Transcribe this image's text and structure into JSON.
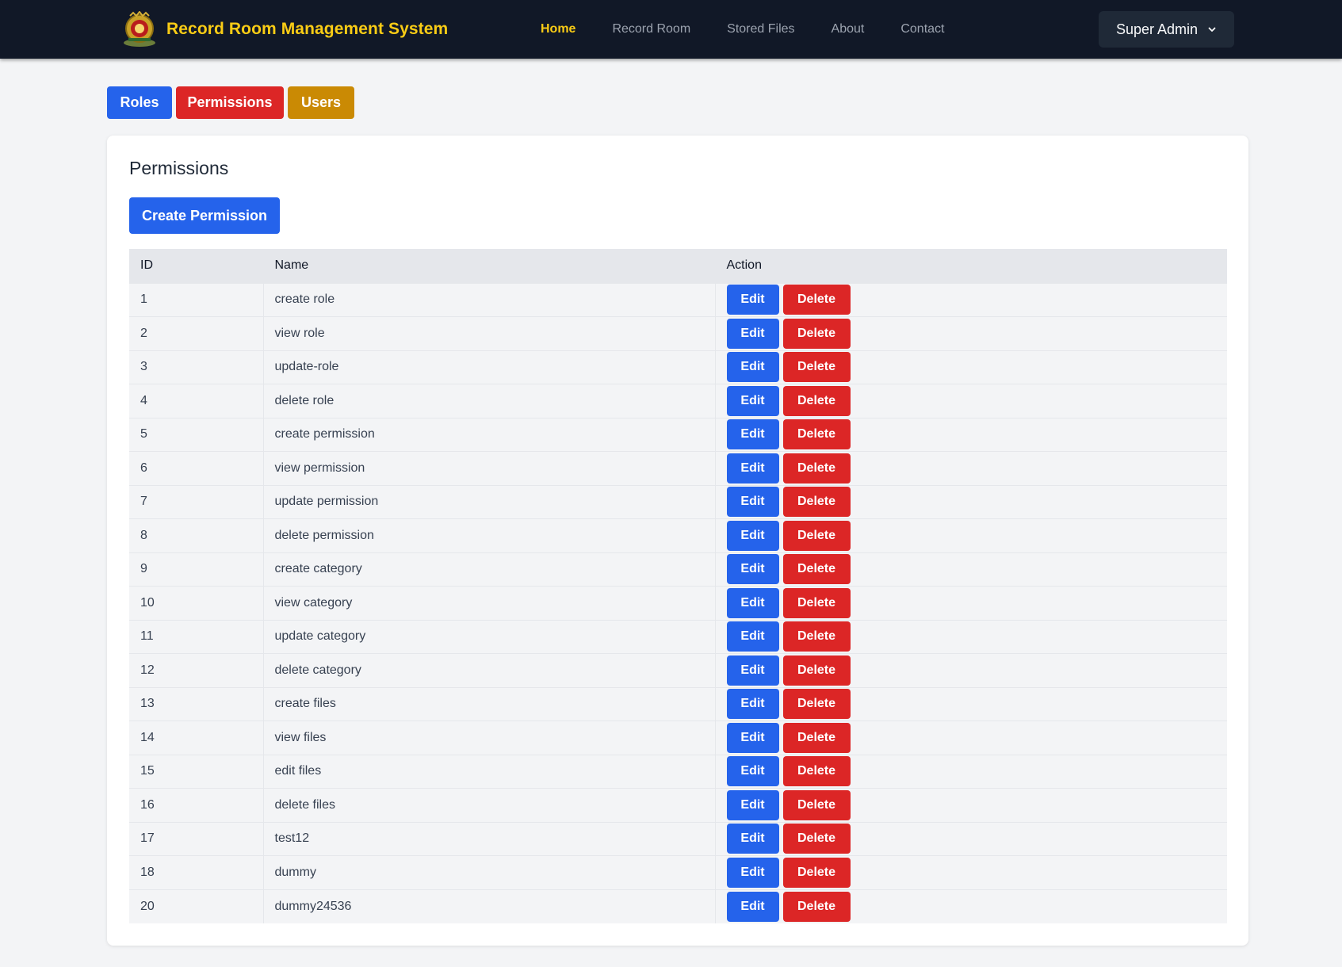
{
  "nav": {
    "brand": "Record Room Management System",
    "links": [
      {
        "label": "Home",
        "active": true
      },
      {
        "label": "Record Room",
        "active": false
      },
      {
        "label": "Stored Files",
        "active": false
      },
      {
        "label": "About",
        "active": false
      },
      {
        "label": "Contact",
        "active": false
      }
    ],
    "user": "Super Admin"
  },
  "tabs": {
    "roles": "Roles",
    "permissions": "Permissions",
    "users": "Users"
  },
  "page": {
    "title": "Permissions",
    "create_label": "Create Permission"
  },
  "table": {
    "headers": {
      "id": "ID",
      "name": "Name",
      "action": "Action"
    },
    "edit_label": "Edit",
    "delete_label": "Delete",
    "rows": [
      {
        "id": "1",
        "name": "create role"
      },
      {
        "id": "2",
        "name": "view role"
      },
      {
        "id": "3",
        "name": "update-role"
      },
      {
        "id": "4",
        "name": "delete role"
      },
      {
        "id": "5",
        "name": "create permission"
      },
      {
        "id": "6",
        "name": "view permission"
      },
      {
        "id": "7",
        "name": "update permission"
      },
      {
        "id": "8",
        "name": "delete permission"
      },
      {
        "id": "9",
        "name": "create category"
      },
      {
        "id": "10",
        "name": "view category"
      },
      {
        "id": "11",
        "name": "update category"
      },
      {
        "id": "12",
        "name": "delete category"
      },
      {
        "id": "13",
        "name": "create files"
      },
      {
        "id": "14",
        "name": "view files"
      },
      {
        "id": "15",
        "name": "edit files"
      },
      {
        "id": "16",
        "name": "delete files"
      },
      {
        "id": "17",
        "name": "test12"
      },
      {
        "id": "18",
        "name": "dummy"
      },
      {
        "id": "20",
        "name": "dummy24536"
      }
    ]
  },
  "colors": {
    "navbar": "#111827",
    "brand": "#facc15",
    "primary": "#2563eb",
    "danger": "#dc2626",
    "warning": "#ca8a04"
  }
}
